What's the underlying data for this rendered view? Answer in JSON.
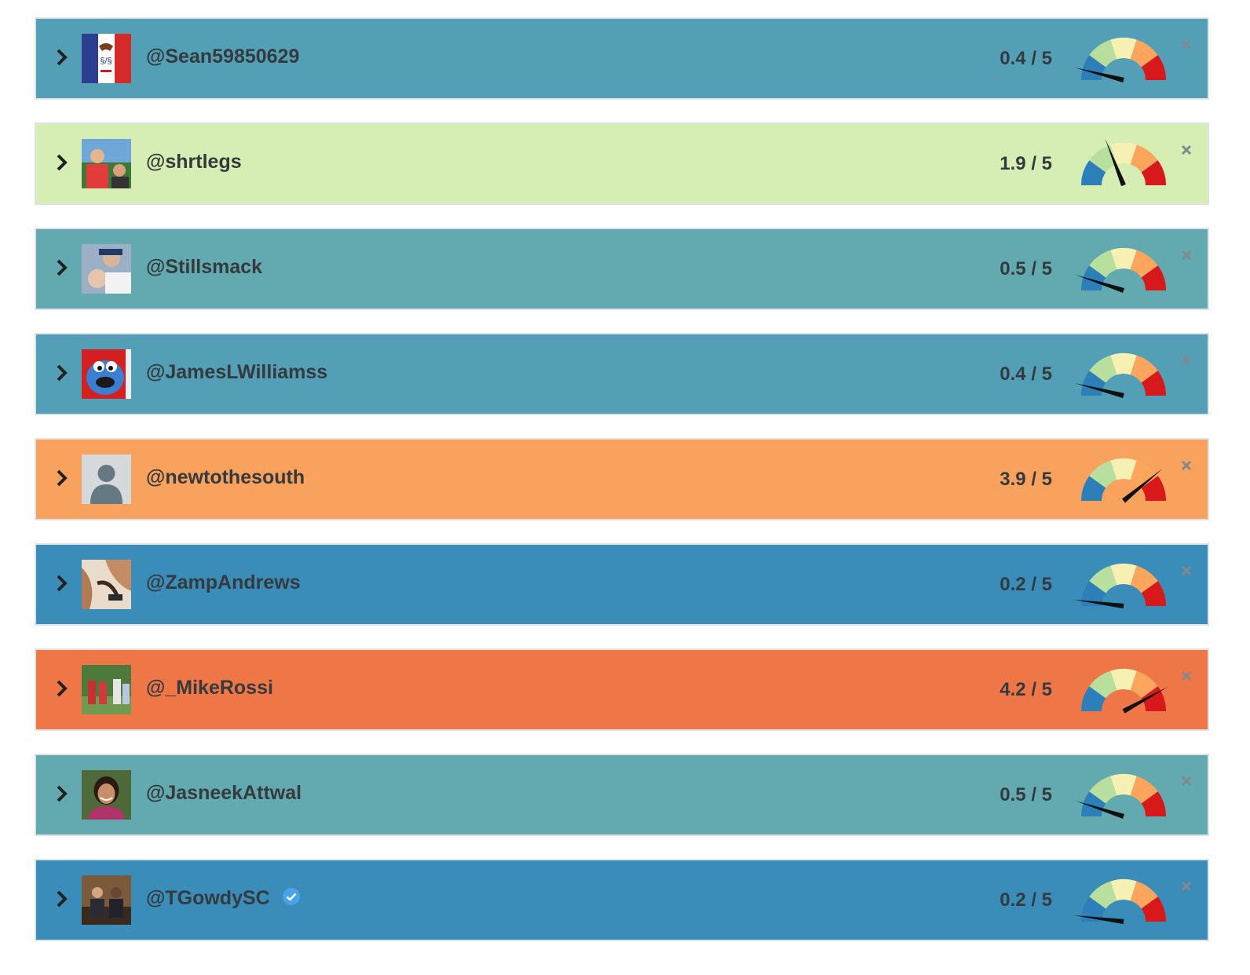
{
  "colors": {
    "gauge_blue": "#2c7fb8",
    "gauge_lightgreen": "#b9df9f",
    "gauge_yellow": "#f6f1b3",
    "gauge_orange": "#fba55d",
    "gauge_red": "#d7191c",
    "verified": "#4aa3e8"
  },
  "accounts": [
    {
      "handle": "@Sean59850629",
      "score_label": "0.4 / 5",
      "score": 0.4,
      "row_color": "#53a0b6",
      "avatar": "flag-iowa-avatar",
      "verified": false
    },
    {
      "handle": "@shrtlegs",
      "score_label": "1.9 / 5",
      "score": 1.9,
      "row_color": "#d6edb3",
      "avatar": "people-outdoor-avatar",
      "verified": false
    },
    {
      "handle": "@Stillsmack",
      "score_label": "0.5 / 5",
      "score": 0.5,
      "row_color": "#62a9b0",
      "avatar": "people-photo-avatar",
      "verified": false
    },
    {
      "handle": "@JamesLWilliamss",
      "score_label": "0.4 / 5",
      "score": 0.4,
      "row_color": "#53a0b6",
      "avatar": "blue-monster-avatar",
      "verified": false
    },
    {
      "handle": "@newtothesouth",
      "score_label": "3.9 / 5",
      "score": 3.9,
      "row_color": "#f9a25d",
      "avatar": "default-user-avatar",
      "verified": false
    },
    {
      "handle": "@ZampAndrews",
      "score_label": "0.2 / 5",
      "score": 0.2,
      "row_color": "#3a8cb9",
      "avatar": "hands-photo-avatar",
      "verified": false
    },
    {
      "handle": "@_MikeRossi",
      "score_label": "4.2 / 5",
      "score": 4.2,
      "row_color": "#ef7647",
      "avatar": "group-photo-avatar",
      "verified": false
    },
    {
      "handle": "@JasneekAttwal",
      "score_label": "0.5 / 5",
      "score": 0.5,
      "row_color": "#62a9b0",
      "avatar": "portrait-photo-avatar",
      "verified": false
    },
    {
      "handle": "@TGowdySC",
      "score_label": "0.2 / 5",
      "score": 0.2,
      "row_color": "#3a8cb9",
      "avatar": "two-men-photo-avatar",
      "verified": true
    }
  ]
}
